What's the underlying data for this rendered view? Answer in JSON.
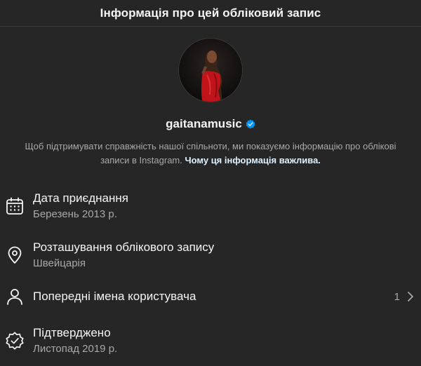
{
  "header": {
    "title": "Інформація про цей обліковий запис"
  },
  "profile": {
    "username": "gaitanamusic",
    "description_text": "Щоб підтримувати справжність нашої спільноти, ми показуємо інформацію про облікові записи в Instagram.",
    "description_link": "Чому ця інформація важлива."
  },
  "rows": [
    {
      "label": "Дата приєднання",
      "value": "Березень 2013 р.",
      "icon": "calendar-icon"
    },
    {
      "label": "Розташування облікового запису",
      "value": "Швейцарія",
      "icon": "location-pin-icon"
    },
    {
      "label": "Попередні імена користувача",
      "count": "1",
      "icon": "user-icon"
    },
    {
      "label": "Підтверджено",
      "value": "Листопад 2019 р.",
      "icon": "verified-badge-icon"
    }
  ],
  "colors": {
    "background": "#262626",
    "verified_blue": "#0095f6",
    "secondary_text": "#a8a8a8"
  }
}
